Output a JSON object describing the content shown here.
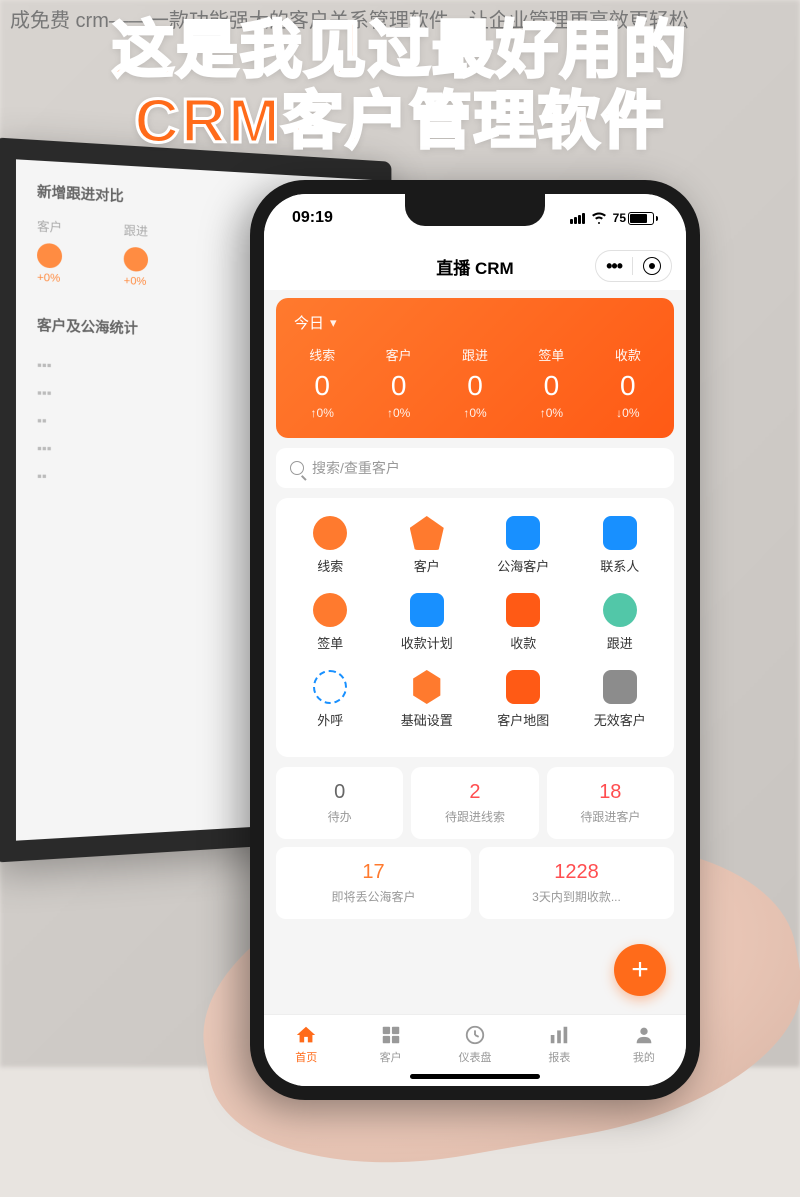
{
  "article_title": "成免费 crm——一款功能强大的客户关系管理软件，让企业管理更高效更轻松",
  "headline_line1": "这是我见过最好用的",
  "headline_line2": "CRM客户管理软件",
  "bg_monitor": {
    "section1_title": "新增跟进对比",
    "col1_label": "客户",
    "col2_label": "跟进",
    "pct": "+0%",
    "section2_title": "客户及公海统计"
  },
  "status": {
    "time": "09:19",
    "battery": "75"
  },
  "app": {
    "title": "直播 CRM"
  },
  "today": {
    "header": "今日",
    "stats": [
      {
        "label": "线索",
        "value": "0",
        "pct": "↑0%"
      },
      {
        "label": "客户",
        "value": "0",
        "pct": "↑0%"
      },
      {
        "label": "跟进",
        "value": "0",
        "pct": "↑0%"
      },
      {
        "label": "签单",
        "value": "0",
        "pct": "↑0%"
      },
      {
        "label": "收款",
        "value": "0",
        "pct": "↓0%"
      }
    ]
  },
  "search": {
    "placeholder": "搜索/查重客户"
  },
  "grid": [
    [
      {
        "label": "线索",
        "icon": "ic-leads"
      },
      {
        "label": "客户",
        "icon": "ic-customer"
      },
      {
        "label": "公海客户",
        "icon": "ic-pool"
      },
      {
        "label": "联系人",
        "icon": "ic-contact"
      }
    ],
    [
      {
        "label": "签单",
        "icon": "ic-order"
      },
      {
        "label": "收款计划",
        "icon": "ic-plan"
      },
      {
        "label": "收款",
        "icon": "ic-payment"
      },
      {
        "label": "跟进",
        "icon": "ic-followup"
      }
    ],
    [
      {
        "label": "外呼",
        "icon": "ic-call"
      },
      {
        "label": "基础设置",
        "icon": "ic-settings"
      },
      {
        "label": "客户地图",
        "icon": "ic-map"
      },
      {
        "label": "无效客户",
        "icon": "ic-invalid"
      }
    ]
  ],
  "summary": [
    {
      "value": "0",
      "label": "待办",
      "cls": "sv-gray"
    },
    {
      "value": "2",
      "label": "待跟进线索",
      "cls": "sv-red"
    },
    {
      "value": "18",
      "label": "待跟进客户",
      "cls": "sv-red"
    },
    {
      "value": "17",
      "label": "即将丢公海客户",
      "cls": "sv-orange"
    },
    {
      "value": "1228",
      "label": "3天内到期收款...",
      "cls": "sv-red"
    }
  ],
  "tabs": [
    {
      "label": "首页",
      "active": true
    },
    {
      "label": "客户",
      "active": false
    },
    {
      "label": "仪表盘",
      "active": false
    },
    {
      "label": "报表",
      "active": false
    },
    {
      "label": "我的",
      "active": false
    }
  ]
}
